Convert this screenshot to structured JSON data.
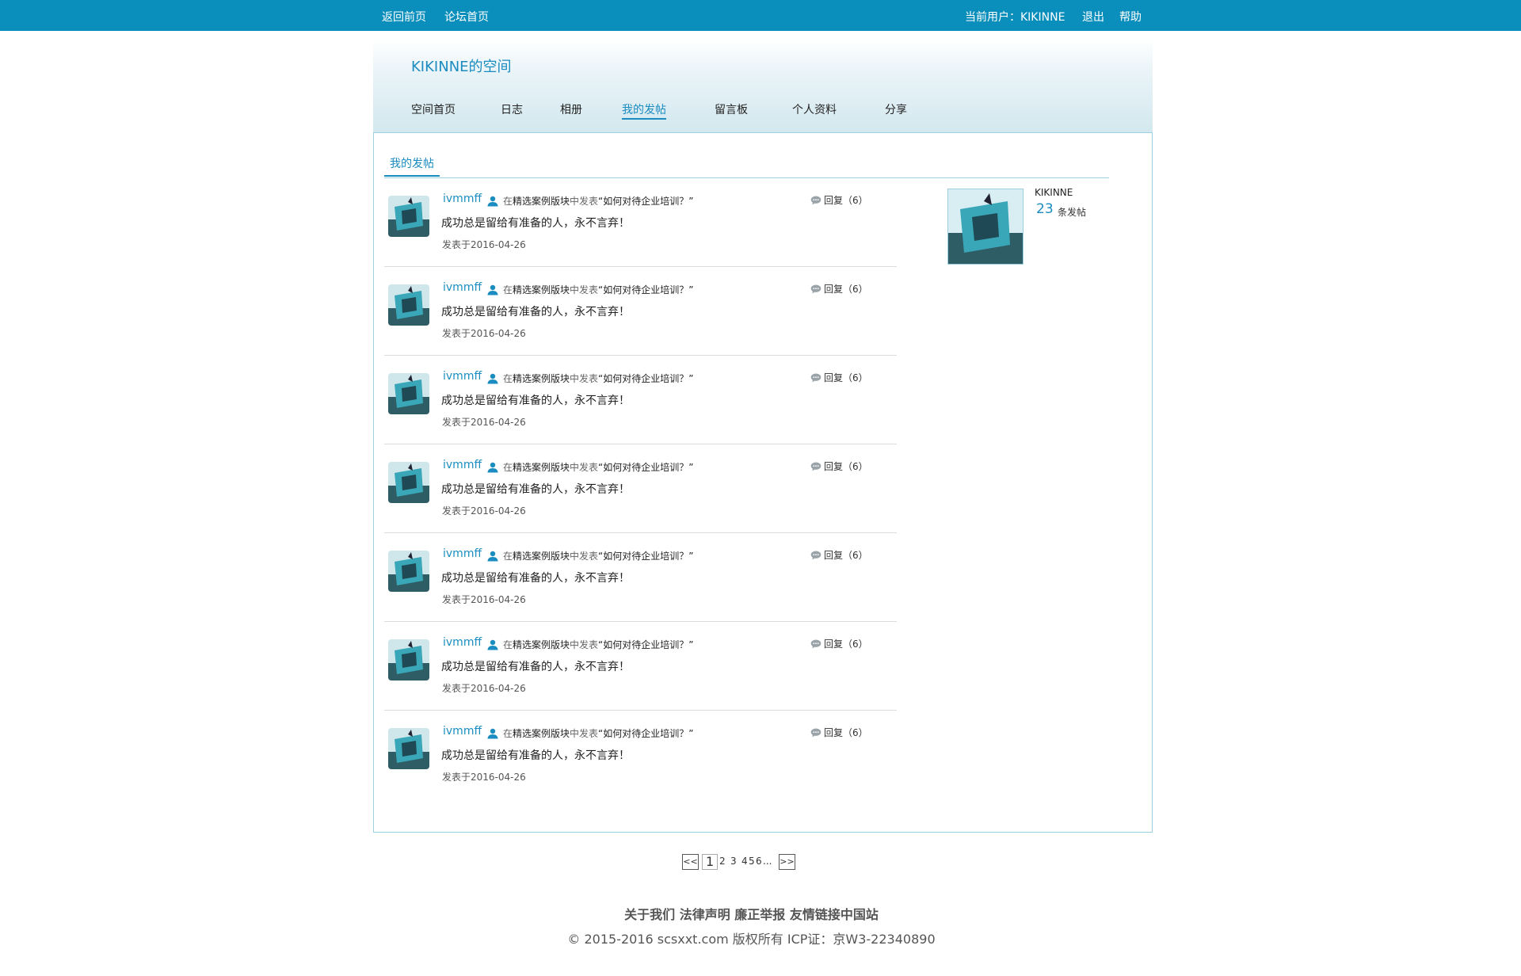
{
  "topbar": {
    "links": [
      "返回前页",
      "论坛首页"
    ],
    "current_user": "当前用户：KIKINNE",
    "logout": "退出",
    "help": "帮助"
  },
  "header": {
    "space_title": "KIKINNE的空间",
    "nav": [
      "空间首页",
      "日志",
      "相册",
      "我的发帖",
      "留言板",
      "个人资料",
      "分享"
    ],
    "active_nav": "我的发帖"
  },
  "section_tab": "我的发帖",
  "posts": [
    {
      "user": "ivmmff",
      "prefix": "在",
      "board": "精选案例版块",
      "mid": "中发表",
      "topic": "“如何对待企业培训？”",
      "reply_label": "回复（6）",
      "content": "成功总是留给有准备的人，永不言弃！",
      "date": "发表于2016-04-26"
    },
    {
      "user": "ivmmff",
      "prefix": "在",
      "board": "精选案例版块",
      "mid": "中发表",
      "topic": "“如何对待企业培训？”",
      "reply_label": "回复（6）",
      "content": "成功总是留给有准备的人，永不言弃！",
      "date": "发表于2016-04-26"
    },
    {
      "user": "ivmmff",
      "prefix": "在",
      "board": "精选案例版块",
      "mid": "中发表",
      "topic": "“如何对待企业培训？”",
      "reply_label": "回复（6）",
      "content": "成功总是留给有准备的人，永不言弃！",
      "date": "发表于2016-04-26"
    },
    {
      "user": "ivmmff",
      "prefix": "在",
      "board": "精选案例版块",
      "mid": "中发表",
      "topic": "“如何对待企业培训？”",
      "reply_label": "回复（6）",
      "content": "成功总是留给有准备的人，永不言弃！",
      "date": "发表于2016-04-26"
    },
    {
      "user": "ivmmff",
      "prefix": "在",
      "board": "精选案例版块",
      "mid": "中发表",
      "topic": "“如何对待企业培训？”",
      "reply_label": "回复（6）",
      "content": "成功总是留给有准备的人，永不言弃！",
      "date": "发表于2016-04-26"
    },
    {
      "user": "ivmmff",
      "prefix": "在",
      "board": "精选案例版块",
      "mid": "中发表",
      "topic": "“如何对待企业培训？”",
      "reply_label": "回复（6）",
      "content": "成功总是留给有准备的人，永不言弃！",
      "date": "发表于2016-04-26"
    },
    {
      "user": "ivmmff",
      "prefix": "在",
      "board": "精选案例版块",
      "mid": "中发表",
      "topic": "“如何对待企业培训？”",
      "reply_label": "回复（6）",
      "content": "成功总是留给有准备的人，永不言弃！",
      "date": "发表于2016-04-26"
    }
  ],
  "profile": {
    "name": "KIKINNE",
    "post_count": "23",
    "post_count_label": "条发帖"
  },
  "pagination": {
    "prev": "<<",
    "next": ">>",
    "current": "1",
    "pages": [
      "2",
      "3",
      "4",
      "5",
      "6"
    ],
    "ellipsis": "..."
  },
  "footer": {
    "links": [
      "关于我们",
      "法律声明",
      "廉正举报",
      "友情链接中国站"
    ],
    "copyright": "© 2015-2016 scsxxt.com 版权所有 ICP证：京W3-22340890"
  },
  "colors": {
    "topbar": "#0a8fbd",
    "accent": "#1b8cc0",
    "border": "#9fd0e2"
  }
}
